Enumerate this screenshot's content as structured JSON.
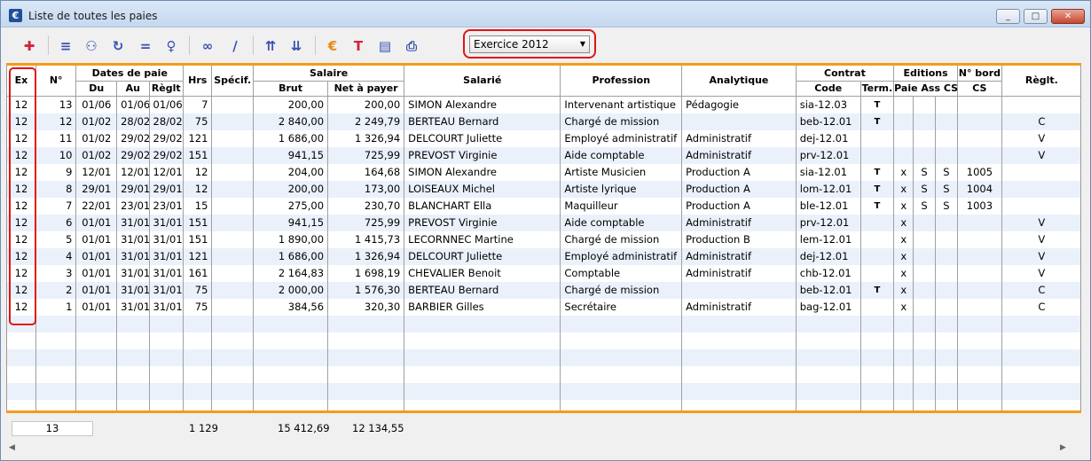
{
  "window": {
    "title": "Liste de toutes les paies",
    "icon": "app-euro-icon",
    "controls": [
      "_",
      "□",
      "✕"
    ]
  },
  "toolbar": {
    "buttons": [
      {
        "name": "add-icon",
        "glyph": "✚"
      },
      {
        "name": "favorite-list-icon",
        "glyph": "≡"
      },
      {
        "name": "person-list-icon",
        "glyph": "⚇"
      },
      {
        "name": "refresh-icon",
        "glyph": "↻"
      },
      {
        "name": "equal-icon",
        "glyph": "="
      },
      {
        "name": "search-person-icon",
        "glyph": "♀"
      },
      {
        "name": "glasses-icon",
        "glyph": "∞"
      },
      {
        "name": "pen-icon",
        "glyph": "/"
      },
      {
        "name": "sort-up-icon",
        "glyph": "⇈"
      },
      {
        "name": "sort-down-icon",
        "glyph": "⇊"
      },
      {
        "name": "euro-coins-icon",
        "glyph": "€"
      },
      {
        "name": "text-edit-icon",
        "glyph": "T"
      },
      {
        "name": "chart-icon",
        "glyph": "▤"
      },
      {
        "name": "printer-icon",
        "glyph": "⎙"
      }
    ],
    "exercice": {
      "selected": "Exercice 2012"
    }
  },
  "table": {
    "headers": {
      "ex": "Ex",
      "no": "N°",
      "dates": "Dates de paie",
      "du": "Du",
      "au": "Au",
      "reglt": "Règlt",
      "hrs": "Hrs",
      "specif": "Spécif.",
      "salaire": "Salaire",
      "brut": "Brut",
      "net": "Net à payer",
      "salarie": "Salarié",
      "profession": "Profession",
      "analytique": "Analytique",
      "contrat": "Contrat",
      "code": "Code",
      "term": "Term.",
      "editions": "Editions",
      "editions_sub": "Paie Ass CS",
      "nbord": "N° bord",
      "nbord_sub": "CS",
      "reglement": "Règlt."
    },
    "rows": [
      [
        "12",
        "13",
        "01/06",
        "01/06",
        "01/06",
        "7",
        "",
        "200,00",
        "200,00",
        "SIMON Alexandre",
        "Intervenant artistique",
        "Pédagogie",
        "sia-12.03",
        "T",
        "",
        "",
        "",
        "",
        ""
      ],
      [
        "12",
        "12",
        "01/02",
        "28/02",
        "28/02",
        "75",
        "",
        "2 840,00",
        "2 249,79",
        "BERTEAU Bernard",
        "Chargé de mission",
        "",
        "beb-12.01",
        "T",
        "",
        "",
        "",
        "",
        "C"
      ],
      [
        "12",
        "11",
        "01/02",
        "29/02",
        "29/02",
        "121",
        "",
        "1 686,00",
        "1 326,94",
        "DELCOURT Juliette",
        "Employé administratif",
        "Administratif",
        "dej-12.01",
        "",
        "",
        "",
        "",
        "",
        "V"
      ],
      [
        "12",
        "10",
        "01/02",
        "29/02",
        "29/02",
        "151",
        "",
        "941,15",
        "725,99",
        "PREVOST Virginie",
        "Aide comptable",
        "Administratif",
        "prv-12.01",
        "",
        "",
        "",
        "",
        "",
        "V"
      ],
      [
        "12",
        "9",
        "12/01",
        "12/01",
        "12/01",
        "12",
        "",
        "204,00",
        "164,68",
        "SIMON Alexandre",
        "Artiste Musicien",
        "Production A",
        "sia-12.01",
        "T",
        "x",
        "S",
        "S",
        "1005",
        ""
      ],
      [
        "12",
        "8",
        "29/01",
        "29/01",
        "29/01",
        "12",
        "",
        "200,00",
        "173,00",
        "LOISEAUX Michel",
        "Artiste lyrique",
        "Production A",
        "lom-12.01",
        "T",
        "x",
        "S",
        "S",
        "1004",
        ""
      ],
      [
        "12",
        "7",
        "22/01",
        "23/01",
        "23/01",
        "15",
        "",
        "275,00",
        "230,70",
        "BLANCHART Ella",
        "Maquilleur",
        "Production A",
        "ble-12.01",
        "T",
        "x",
        "S",
        "S",
        "1003",
        ""
      ],
      [
        "12",
        "6",
        "01/01",
        "31/01",
        "31/01",
        "151",
        "",
        "941,15",
        "725,99",
        "PREVOST Virginie",
        "Aide comptable",
        "Administratif",
        "prv-12.01",
        "",
        "x",
        "",
        "",
        "",
        "V"
      ],
      [
        "12",
        "5",
        "01/01",
        "31/01",
        "31/01",
        "151",
        "",
        "1 890,00",
        "1 415,73",
        "LECORNNEC Martine",
        "Chargé de mission",
        "Production B",
        "lem-12.01",
        "",
        "x",
        "",
        "",
        "",
        "V"
      ],
      [
        "12",
        "4",
        "01/01",
        "31/01",
        "31/01",
        "121",
        "",
        "1 686,00",
        "1 326,94",
        "DELCOURT Juliette",
        "Employé administratif",
        "Administratif",
        "dej-12.01",
        "",
        "x",
        "",
        "",
        "",
        "V"
      ],
      [
        "12",
        "3",
        "01/01",
        "31/01",
        "31/01",
        "161",
        "",
        "2 164,83",
        "1 698,19",
        "CHEVALIER Benoit",
        "Comptable",
        "Administratif",
        "chb-12.01",
        "",
        "x",
        "",
        "",
        "",
        "V"
      ],
      [
        "12",
        "2",
        "01/01",
        "31/01",
        "31/01",
        "75",
        "",
        "2 000,00",
        "1 576,30",
        "BERTEAU Bernard",
        "Chargé de mission",
        "",
        "beb-12.01",
        "T",
        "x",
        "",
        "",
        "",
        "C"
      ],
      [
        "12",
        "1",
        "01/01",
        "31/01",
        "31/01",
        "75",
        "",
        "384,56",
        "320,30",
        "BARBIER Gilles",
        "Secrétaire",
        "Administratif",
        "bag-12.01",
        "",
        "x",
        "",
        "",
        "",
        "C"
      ]
    ],
    "empty_rows": 6
  },
  "footer": {
    "count": "13",
    "hrs_total": "1 129",
    "brut_total": "15 412,69",
    "net_total": "12 134,55"
  }
}
